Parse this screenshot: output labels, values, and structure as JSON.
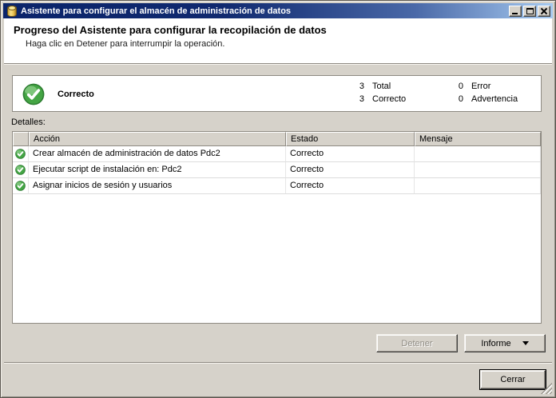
{
  "window": {
    "title": "Asistente para configurar el almacén de administración de datos",
    "icon": "database-icon"
  },
  "header": {
    "title": "Progreso del Asistente para configurar la recopilación de datos",
    "subtitle": "Haga clic en Detener para interrumpir la operación."
  },
  "summary": {
    "status": "Correcto",
    "icon": "success-check-icon",
    "counts": [
      {
        "value": "3",
        "label": "Total"
      },
      {
        "value": "3",
        "label": "Correcto"
      },
      {
        "value": "0",
        "label": "Error"
      },
      {
        "value": "0",
        "label": "Advertencia"
      }
    ]
  },
  "details": {
    "label": "Detalles:",
    "table": {
      "columns": [
        "Acción",
        "Estado",
        "Mensaje"
      ],
      "rows": [
        {
          "icon": "success-check-icon",
          "action": "Crear almacén de administración de datos Pdc2",
          "status": "Correcto",
          "message": ""
        },
        {
          "icon": "success-check-icon",
          "action": "Ejecutar script de instalación en: Pdc2",
          "status": "Correcto",
          "message": ""
        },
        {
          "icon": "success-check-icon",
          "action": "Asignar inicios de sesión y usuarios",
          "status": "Correcto",
          "message": ""
        }
      ]
    }
  },
  "buttons": {
    "stop": {
      "label": "Detener",
      "enabled": false
    },
    "report": {
      "label": "Informe",
      "icon": "dropdown-arrow-icon"
    },
    "close": {
      "label": "Cerrar"
    }
  },
  "colors": {
    "titlebar_left": "#0a246a",
    "titlebar_right": "#a6caf0",
    "dialog_bg": "#d6d2ca",
    "success_green": "#44a544"
  }
}
